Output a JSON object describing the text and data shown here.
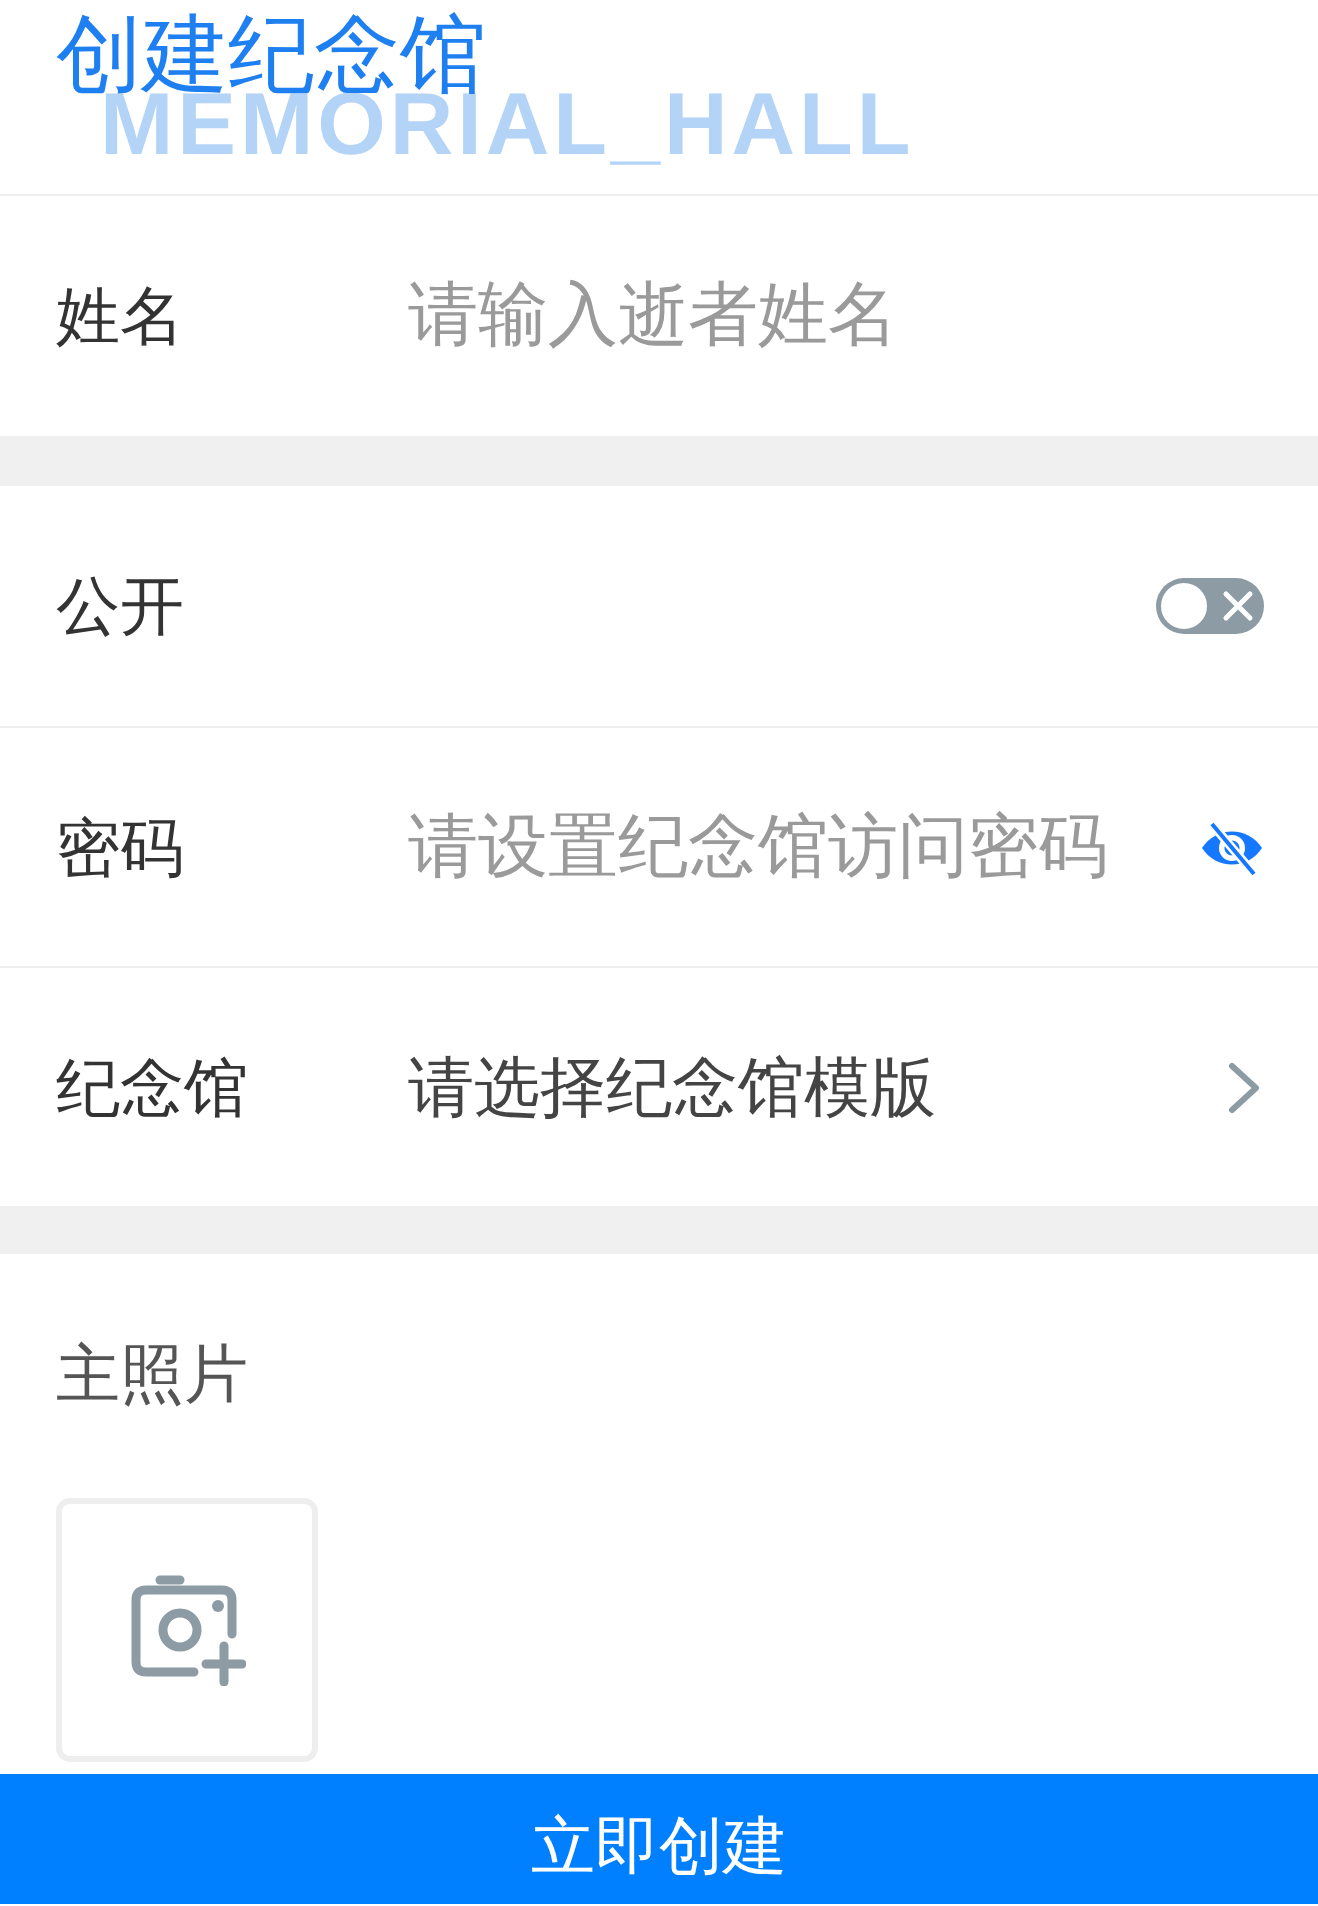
{
  "header": {
    "title": "创建纪念馆",
    "background_text": "MEMORIAL_HALL"
  },
  "sections": [
    {
      "rows": [
        {
          "kind": "input",
          "label": "姓名",
          "placeholder": "请输入逝者姓名"
        }
      ]
    },
    {
      "rows": [
        {
          "kind": "switch",
          "label": "公开",
          "on": false
        },
        {
          "kind": "password",
          "label": "密码",
          "placeholder": "请设置纪念馆访问密码",
          "visible": false
        },
        {
          "kind": "select",
          "label": "纪念馆",
          "value": "请选择纪念馆模版"
        }
      ]
    },
    {
      "rows": [
        {
          "kind": "upload",
          "label": "主照片"
        }
      ]
    }
  ],
  "submit_button": "立即创建"
}
